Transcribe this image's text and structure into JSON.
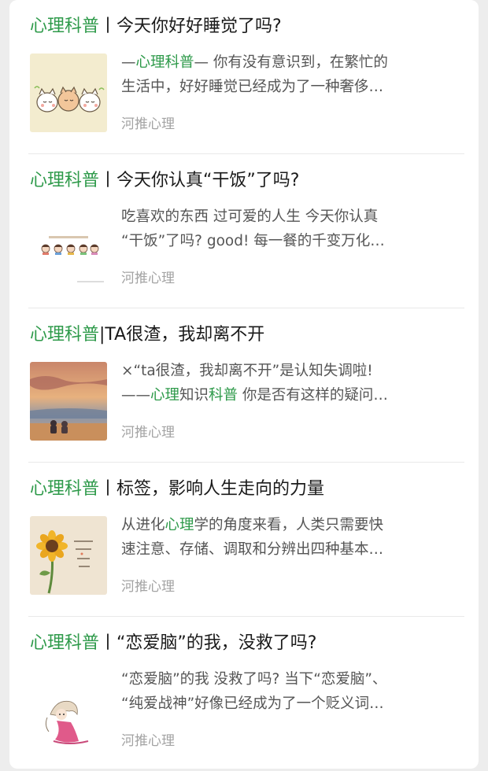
{
  "articles": [
    {
      "title_prefix": "心理科普",
      "title_rest": "丨今天你好好睡觉了吗?",
      "desc_line1_a": "—",
      "desc_line1_hl": "心理科普",
      "desc_line1_b": "— 你有没有意识到，在繁忙的",
      "desc_line2": "生活中，好好睡觉已经成为了一种奢侈…",
      "source": "河推心理",
      "thumb_icon": "sleeping-cats-illustration"
    },
    {
      "title_prefix": "心理科普",
      "title_rest": "丨今天你认真“干饭”了吗?",
      "desc_line1": "吃喜欢的东西 过可爱的人生 今天你认真",
      "desc_line2": "“干饭”了吗? good! 每一餐的千变万化…",
      "source": "河推心理",
      "thumb_icon": "cartoon-faces-illustration"
    },
    {
      "title_prefix": "心理科普",
      "title_rest": "|TA很渣，我却离不开",
      "desc_line1": "×“ta很渣，我却离不开”是认知失调啦!",
      "desc_line2_a": "——",
      "desc_line2_hl1": "心理",
      "desc_line2_b": "知识",
      "desc_line2_hl2": "科普",
      "desc_line2_c": " 你是否有这样的疑问…",
      "source": "河推心理",
      "thumb_icon": "sunset-couple-illustration"
    },
    {
      "title_prefix": "心理科普",
      "title_rest": "丨标签，影响人生走向的力量",
      "desc_line1_a": "从进化",
      "desc_line1_hl": "心理",
      "desc_line1_b": "学的角度来看，人类只需要快",
      "desc_line2": "速注意、存储、调取和分辨出四种基本…",
      "source": "河推心理",
      "thumb_icon": "sunflower-illustration"
    },
    {
      "title_prefix": "心理科普",
      "title_rest": "丨“恋爱脑”的我，没救了吗?",
      "desc_line1": "“恋爱脑”的我 没救了吗? 当下“恋爱脑”、",
      "desc_line2": "“纯爱战神”好像已经成为了一个贬义词…",
      "source": "河推心理",
      "thumb_icon": "cartoon-girl-illustration"
    }
  ],
  "colors": {
    "accent": "#2e9a4a",
    "text": "#1a1a1a",
    "muted": "#a3a3a3"
  }
}
